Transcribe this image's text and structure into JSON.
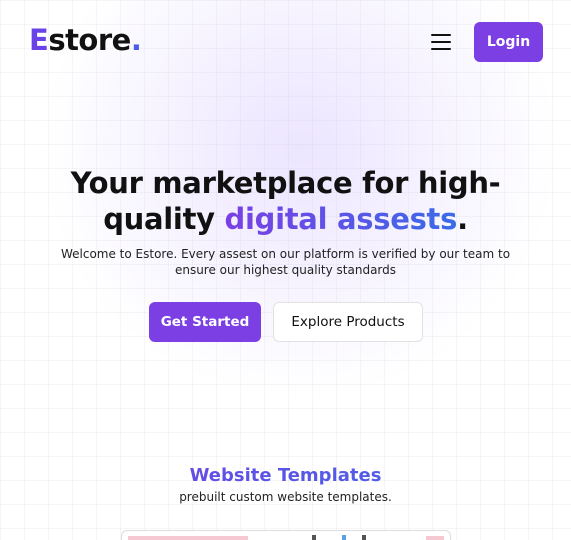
{
  "header": {
    "logo_first": "E",
    "logo_rest": "store",
    "logo_dot": ".",
    "login_label": "Login"
  },
  "hero": {
    "title_line1": "Your marketplace for high-",
    "title_line2_plain": "quality ",
    "title_line2_accent": "digital assests",
    "title_line2_end": ".",
    "subtitle": "Welcome to Estore. Every assest on our platform is verified by our team to ensure our highest quality standards",
    "primary_cta": "Get Started",
    "secondary_cta": "Explore Products"
  },
  "section": {
    "title": "Website Templates",
    "subtitle": "prebuilt custom website templates."
  },
  "colors": {
    "accent": "#7b3fe4",
    "accent_blue": "#3a6be8",
    "text": "#111111"
  },
  "icons": {
    "menu": "hamburger-menu-icon"
  }
}
